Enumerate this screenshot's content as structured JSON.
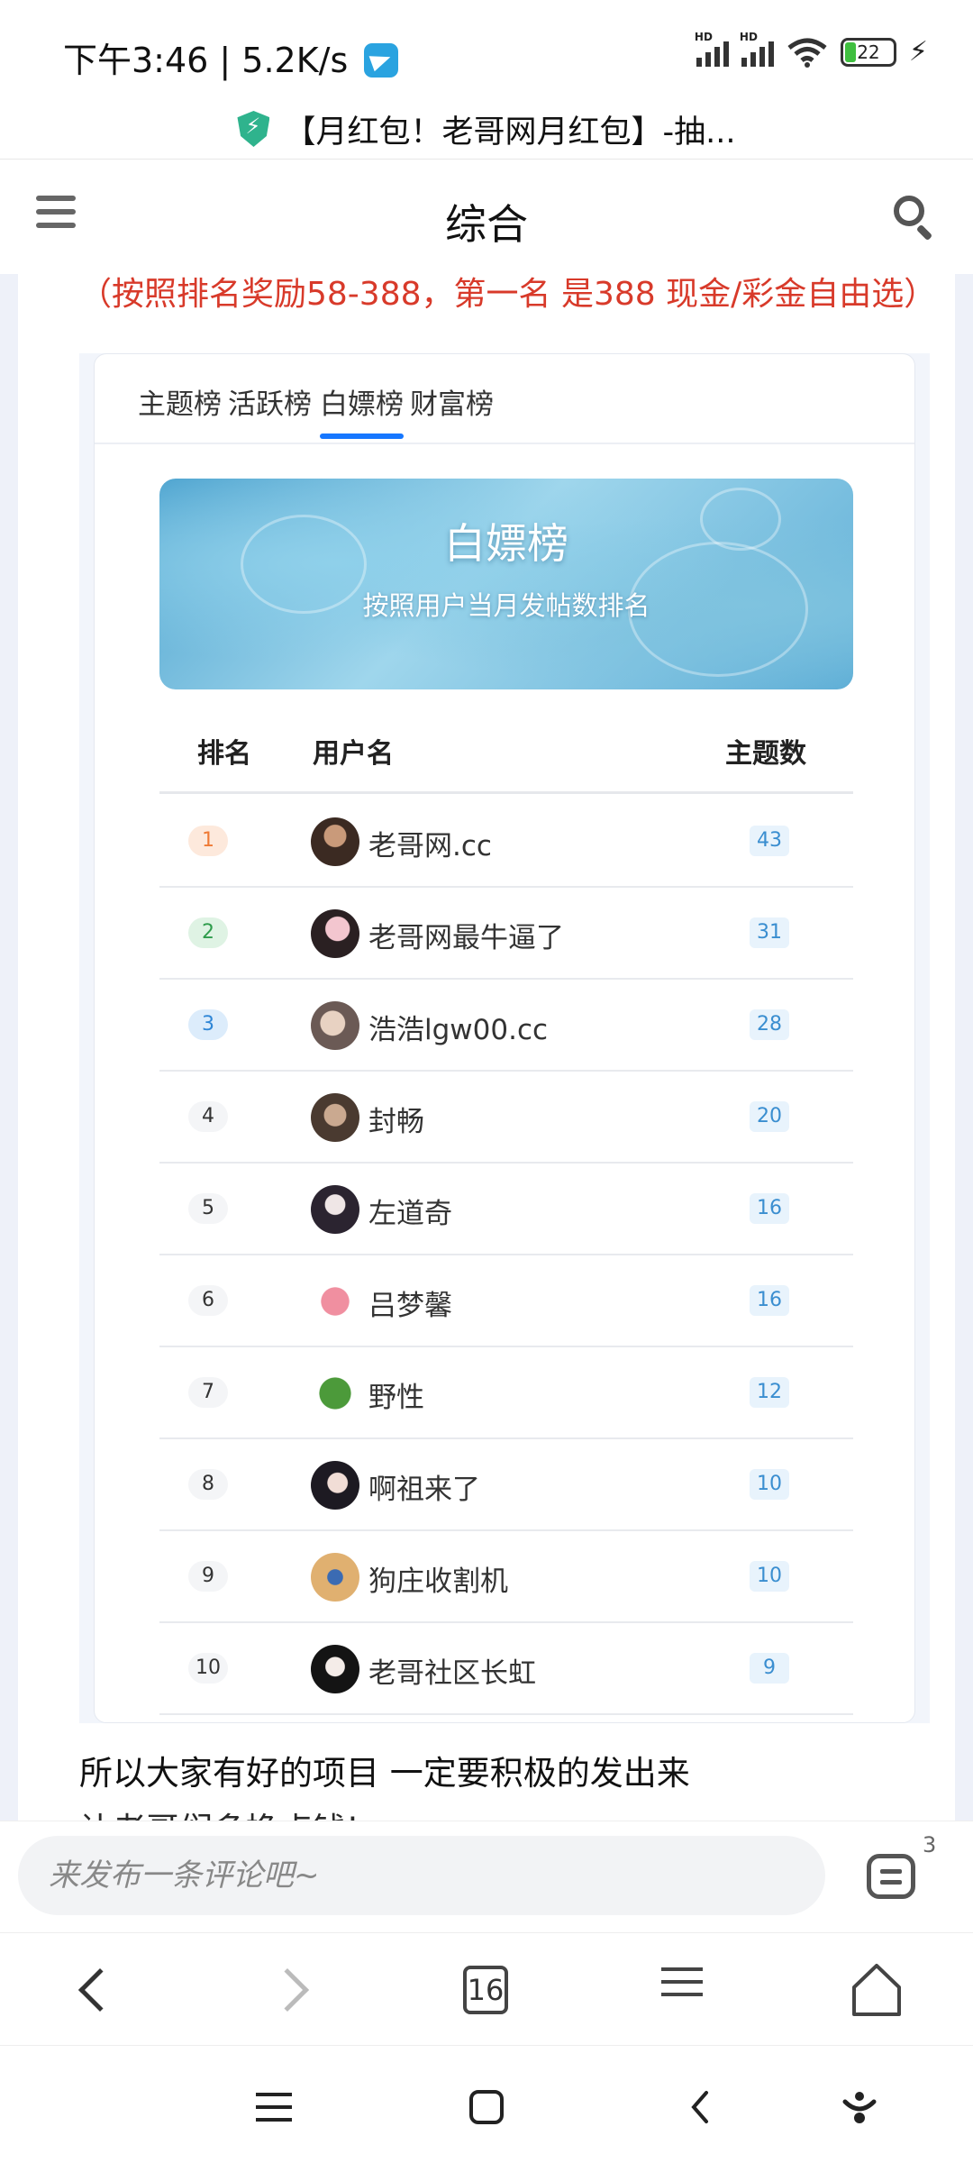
{
  "status_bar": {
    "time_speed": "下午3:46 | 5.2K/s",
    "network_labels": [
      "HD",
      "HD"
    ],
    "battery": "22"
  },
  "url_bar": {
    "page_title": "【月红包！老哥网月红包】-抽..."
  },
  "top_nav": {
    "title": "综合"
  },
  "article": {
    "reward_note": "（按照排名奖励58-388，第一名 是388 现金/彩金自由选）",
    "paragraph_1": "所以大家有好的项目 一定要积极的发出来",
    "paragraph_2_partial": "让老哥们多挣点钱!"
  },
  "leaderboard": {
    "tabs": [
      {
        "label": "主题榜",
        "active": false
      },
      {
        "label": "活跃榜",
        "active": false
      },
      {
        "label": "白嫖榜",
        "active": true
      },
      {
        "label": "财富榜",
        "active": false
      }
    ],
    "banner_title": "白嫖榜",
    "banner_subtitle": "按照用户当月发帖数排名",
    "columns": [
      "排名",
      "用户名",
      "主题数"
    ],
    "rows": [
      {
        "rank": "1",
        "user": "老哥网.cc",
        "count": "43"
      },
      {
        "rank": "2",
        "user": "老哥网最牛逼了",
        "count": "31"
      },
      {
        "rank": "3",
        "user": "浩浩lgw00.cc",
        "count": "28"
      },
      {
        "rank": "4",
        "user": "封畅",
        "count": "20"
      },
      {
        "rank": "5",
        "user": "左道奇",
        "count": "16"
      },
      {
        "rank": "6",
        "user": "吕梦馨",
        "count": "16"
      },
      {
        "rank": "7",
        "user": "野性",
        "count": "12"
      },
      {
        "rank": "8",
        "user": "啊祖来了",
        "count": "10"
      },
      {
        "rank": "9",
        "user": "狗庄收割机",
        "count": "10"
      },
      {
        "rank": "10",
        "user": "老哥社区长虹",
        "count": "9"
      }
    ]
  },
  "comment_bar": {
    "placeholder": "来发布一条评论吧~",
    "comment_count": "3"
  },
  "browser_nav": {
    "tab_count": "16"
  },
  "colors": {
    "accent": "#1677ff",
    "reward_red": "#d83a2a"
  }
}
